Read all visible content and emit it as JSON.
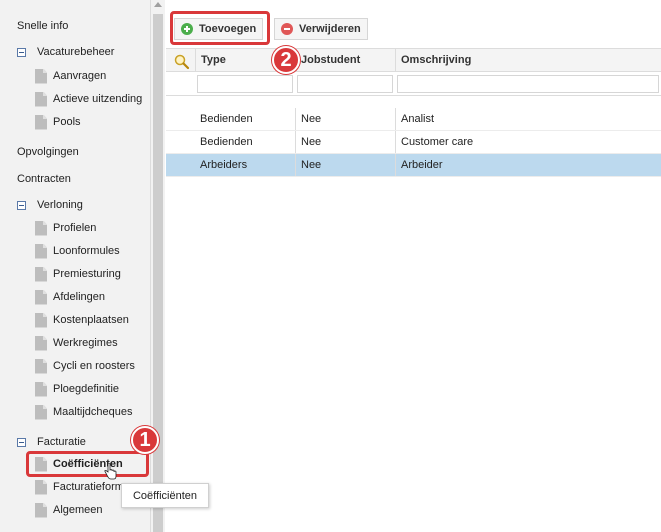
{
  "sidebar": {
    "top_items": [
      "Snelle info",
      "Opvolgingen",
      "Contracten"
    ],
    "groups": [
      {
        "label": "Vacaturebeheer",
        "items": [
          "Aanvragen",
          "Actieve uitzending",
          "Pools"
        ]
      },
      {
        "label": "Verloning",
        "items": [
          "Profielen",
          "Loonformules",
          "Premiesturing",
          "Afdelingen",
          "Kostenplaatsen",
          "Werkregimes",
          "Cycli en roosters",
          "Ploegdefinitie",
          "Maaltijdcheques"
        ]
      },
      {
        "label": "Facturatie",
        "items": [
          "Coëfficiënten",
          "Facturatieform",
          "Algemeen"
        ]
      }
    ]
  },
  "toolbar": {
    "add_label": "Toevoegen",
    "delete_label": "Verwijderen"
  },
  "grid": {
    "columns": [
      "Type",
      "Jobstudent",
      "Omschrijving"
    ],
    "rows": [
      [
        "Bedienden",
        "Nee",
        "Analist"
      ],
      [
        "Bedienden",
        "Nee",
        "Customer care"
      ],
      [
        "Arbeiders",
        "Nee",
        "Arbeider"
      ]
    ]
  },
  "tooltip": "Coëfficiënten",
  "callouts": [
    "1",
    "2"
  ],
  "colors": {
    "highlight": "#d9383a",
    "selected_row": "#bcd9ee"
  }
}
